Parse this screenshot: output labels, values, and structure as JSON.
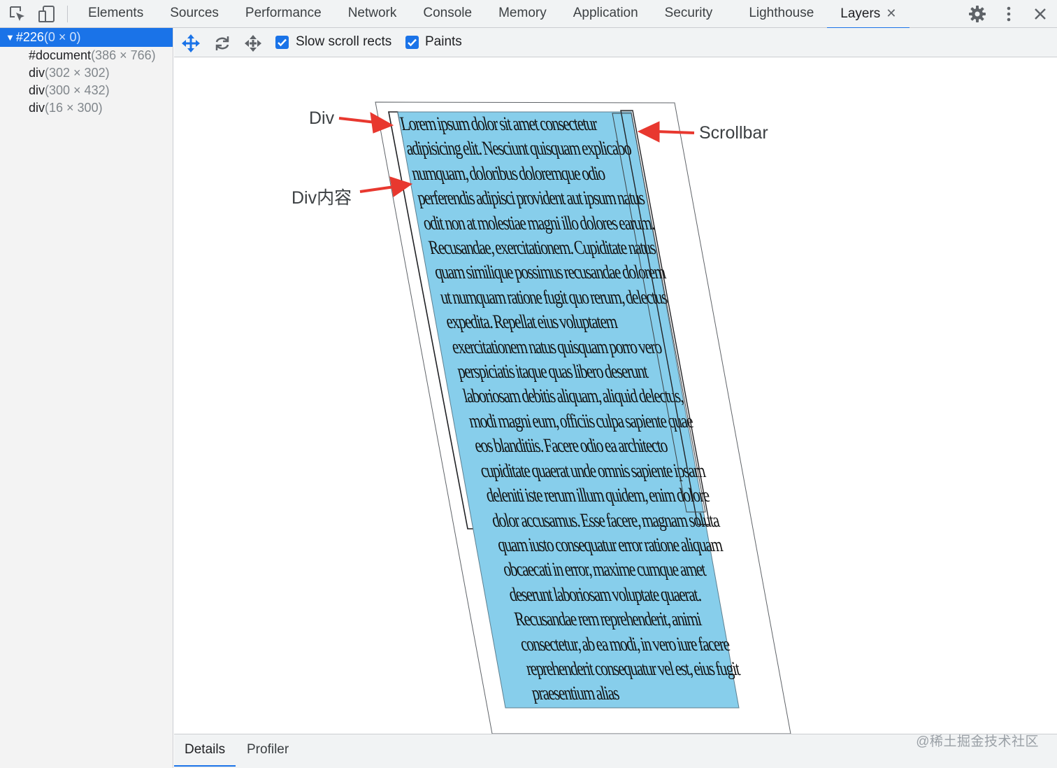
{
  "topbar": {
    "tabs": [
      {
        "label": "Elements"
      },
      {
        "label": "Sources"
      },
      {
        "label": "Performance"
      },
      {
        "label": "Network"
      },
      {
        "label": "Console"
      },
      {
        "label": "Memory"
      },
      {
        "label": "Application"
      },
      {
        "label": "Security"
      },
      {
        "label": "Lighthouse"
      },
      {
        "label": "Layers",
        "active": true
      }
    ],
    "close_glyph": "✕",
    "icons": [
      "inspect-element-icon",
      "device-toggle-icon",
      "settings-gear-icon",
      "more-vertical-icon",
      "close-devtools-icon"
    ]
  },
  "layer_tree": {
    "root": {
      "name": "#226",
      "size": "(0 × 0)",
      "expanded_glyph": "▼"
    },
    "children": [
      {
        "name": "#document",
        "size": "(386 × 766)"
      },
      {
        "name": "div",
        "size": "(302 × 302)"
      },
      {
        "name": "div",
        "size": "(300 × 432)"
      },
      {
        "name": "div",
        "size": "(16 × 300)"
      }
    ]
  },
  "toolbar": {
    "icons": [
      "pan-mode-icon",
      "rotate-mode-icon",
      "reset-transform-icon"
    ],
    "checkboxes": [
      {
        "label": "Slow scroll rects",
        "checked": true
      },
      {
        "label": "Paints",
        "checked": true
      }
    ]
  },
  "viewport": {
    "content_text": "Lorem ipsum dolor sit amet consectetur adipisicing elit. Nesciunt quisquam explicabo numquam, doloribus doloremque odio perferendis adipisci provident aut ipsum natus odit non at molestiae magni illo dolores earum. Recusandae, exercitationem. Cupiditate natus quam similique possimus recusandae dolorem ut numquam ratione fugit quo rerum, delectus expedita. Repellat eius voluptatem exercitationem natus quisquam porro vero perspiciatis itaque quas libero deserunt laboriosam debitis aliquam, aliquid delectus, modi magni eum, officiis culpa sapiente quae eos blanditiis. Facere odio ea architecto cupiditate quaerat unde omnis sapiente ipsam deleniti iste rerum illum quidem, enim dolore dolor accusamus. Esse facere, magnam soluta quam iusto consequatur error ratione aliquam obcaecati in error, maxime cumque amet deserunt laboriosam voluptate quaerat. Recusandae rem reprehenderit, animi consectetur, ab ea modi, in vero iure facere reprehenderit consequatur vel est, eius fugit praesentium alias",
    "annotations": {
      "div": "Div",
      "div_content": "Div内容",
      "scrollbar": "Scrollbar"
    },
    "colors": {
      "layer_fill": "#87ceeb",
      "arrow": "#e8382f",
      "outline": "#3c4043"
    }
  },
  "bottom_tabs": [
    {
      "label": "Details",
      "active": true
    },
    {
      "label": "Profiler"
    }
  ],
  "watermark": "@稀土掘金技术社区"
}
